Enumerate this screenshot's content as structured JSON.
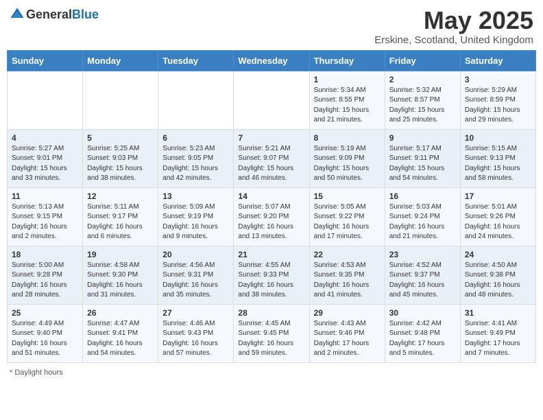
{
  "header": {
    "logo_general": "General",
    "logo_blue": "Blue",
    "title": "May 2025",
    "subtitle": "Erskine, Scotland, United Kingdom"
  },
  "days_of_week": [
    "Sunday",
    "Monday",
    "Tuesday",
    "Wednesday",
    "Thursday",
    "Friday",
    "Saturday"
  ],
  "weeks": [
    [
      {
        "day": "",
        "info": ""
      },
      {
        "day": "",
        "info": ""
      },
      {
        "day": "",
        "info": ""
      },
      {
        "day": "",
        "info": ""
      },
      {
        "day": "1",
        "info": "Sunrise: 5:34 AM\nSunset: 8:55 PM\nDaylight: 15 hours\nand 21 minutes."
      },
      {
        "day": "2",
        "info": "Sunrise: 5:32 AM\nSunset: 8:57 PM\nDaylight: 15 hours\nand 25 minutes."
      },
      {
        "day": "3",
        "info": "Sunrise: 5:29 AM\nSunset: 8:59 PM\nDaylight: 15 hours\nand 29 minutes."
      }
    ],
    [
      {
        "day": "4",
        "info": "Sunrise: 5:27 AM\nSunset: 9:01 PM\nDaylight: 15 hours\nand 33 minutes."
      },
      {
        "day": "5",
        "info": "Sunrise: 5:25 AM\nSunset: 9:03 PM\nDaylight: 15 hours\nand 38 minutes."
      },
      {
        "day": "6",
        "info": "Sunrise: 5:23 AM\nSunset: 9:05 PM\nDaylight: 15 hours\nand 42 minutes."
      },
      {
        "day": "7",
        "info": "Sunrise: 5:21 AM\nSunset: 9:07 PM\nDaylight: 15 hours\nand 46 minutes."
      },
      {
        "day": "8",
        "info": "Sunrise: 5:19 AM\nSunset: 9:09 PM\nDaylight: 15 hours\nand 50 minutes."
      },
      {
        "day": "9",
        "info": "Sunrise: 5:17 AM\nSunset: 9:11 PM\nDaylight: 15 hours\nand 54 minutes."
      },
      {
        "day": "10",
        "info": "Sunrise: 5:15 AM\nSunset: 9:13 PM\nDaylight: 15 hours\nand 58 minutes."
      }
    ],
    [
      {
        "day": "11",
        "info": "Sunrise: 5:13 AM\nSunset: 9:15 PM\nDaylight: 16 hours\nand 2 minutes."
      },
      {
        "day": "12",
        "info": "Sunrise: 5:11 AM\nSunset: 9:17 PM\nDaylight: 16 hours\nand 6 minutes."
      },
      {
        "day": "13",
        "info": "Sunrise: 5:09 AM\nSunset: 9:19 PM\nDaylight: 16 hours\nand 9 minutes."
      },
      {
        "day": "14",
        "info": "Sunrise: 5:07 AM\nSunset: 9:20 PM\nDaylight: 16 hours\nand 13 minutes."
      },
      {
        "day": "15",
        "info": "Sunrise: 5:05 AM\nSunset: 9:22 PM\nDaylight: 16 hours\nand 17 minutes."
      },
      {
        "day": "16",
        "info": "Sunrise: 5:03 AM\nSunset: 9:24 PM\nDaylight: 16 hours\nand 21 minutes."
      },
      {
        "day": "17",
        "info": "Sunrise: 5:01 AM\nSunset: 9:26 PM\nDaylight: 16 hours\nand 24 minutes."
      }
    ],
    [
      {
        "day": "18",
        "info": "Sunrise: 5:00 AM\nSunset: 9:28 PM\nDaylight: 16 hours\nand 28 minutes."
      },
      {
        "day": "19",
        "info": "Sunrise: 4:58 AM\nSunset: 9:30 PM\nDaylight: 16 hours\nand 31 minutes."
      },
      {
        "day": "20",
        "info": "Sunrise: 4:56 AM\nSunset: 9:31 PM\nDaylight: 16 hours\nand 35 minutes."
      },
      {
        "day": "21",
        "info": "Sunrise: 4:55 AM\nSunset: 9:33 PM\nDaylight: 16 hours\nand 38 minutes."
      },
      {
        "day": "22",
        "info": "Sunrise: 4:53 AM\nSunset: 9:35 PM\nDaylight: 16 hours\nand 41 minutes."
      },
      {
        "day": "23",
        "info": "Sunrise: 4:52 AM\nSunset: 9:37 PM\nDaylight: 16 hours\nand 45 minutes."
      },
      {
        "day": "24",
        "info": "Sunrise: 4:50 AM\nSunset: 9:38 PM\nDaylight: 16 hours\nand 48 minutes."
      }
    ],
    [
      {
        "day": "25",
        "info": "Sunrise: 4:49 AM\nSunset: 9:40 PM\nDaylight: 16 hours\nand 51 minutes."
      },
      {
        "day": "26",
        "info": "Sunrise: 4:47 AM\nSunset: 9:41 PM\nDaylight: 16 hours\nand 54 minutes."
      },
      {
        "day": "27",
        "info": "Sunrise: 4:46 AM\nSunset: 9:43 PM\nDaylight: 16 hours\nand 57 minutes."
      },
      {
        "day": "28",
        "info": "Sunrise: 4:45 AM\nSunset: 9:45 PM\nDaylight: 16 hours\nand 59 minutes."
      },
      {
        "day": "29",
        "info": "Sunrise: 4:43 AM\nSunset: 9:46 PM\nDaylight: 17 hours\nand 2 minutes."
      },
      {
        "day": "30",
        "info": "Sunrise: 4:42 AM\nSunset: 9:48 PM\nDaylight: 17 hours\nand 5 minutes."
      },
      {
        "day": "31",
        "info": "Sunrise: 4:41 AM\nSunset: 9:49 PM\nDaylight: 17 hours\nand 7 minutes."
      }
    ]
  ],
  "footer": {
    "note": "Daylight hours"
  }
}
